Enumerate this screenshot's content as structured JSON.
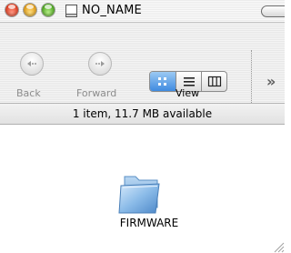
{
  "window": {
    "title": "NO_NAME",
    "title_icon": "disk-icon"
  },
  "toolbar": {
    "back_label": "Back",
    "forward_label": "Forward",
    "view_label": "View",
    "view_modes": [
      "icon-view",
      "list-view",
      "column-view"
    ],
    "selected_view": "icon-view",
    "overflow_symbol": "»"
  },
  "status": {
    "text": "1 item, 11.7 MB available"
  },
  "items": [
    {
      "name": "FIRMWARE",
      "icon": "folder-icon"
    }
  ],
  "colors": {
    "close": "#e03a1e",
    "minimize": "#e39b12",
    "zoom": "#4ba51e",
    "selection_blue": "#3f8ae0"
  }
}
